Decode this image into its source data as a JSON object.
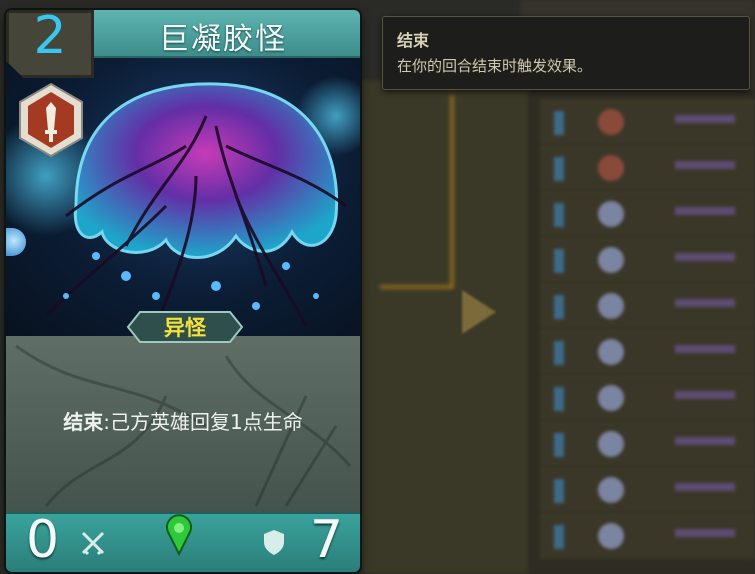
{
  "tooltip": {
    "title": "结束",
    "body": "在你的回合结束时触发效果。"
  },
  "card": {
    "cost": "2",
    "name": "巨凝胶怪",
    "tribe": "异怪",
    "effect_keyword": "结束",
    "effect_text": ":己方英雄回复1点生命",
    "attack": "0",
    "health": "7"
  },
  "colors": {
    "card_frame": "#3aa39c",
    "cost_color": "#39c6ef",
    "tribe_color": "#f7e23a",
    "tooltip_bg": "#1d1d1b"
  },
  "icons": {
    "type_icon": "sword-shield-icon",
    "attack_icon": "crossed-swords-icon",
    "health_icon": "shield-icon",
    "gem_icon": "green-gem-icon"
  }
}
